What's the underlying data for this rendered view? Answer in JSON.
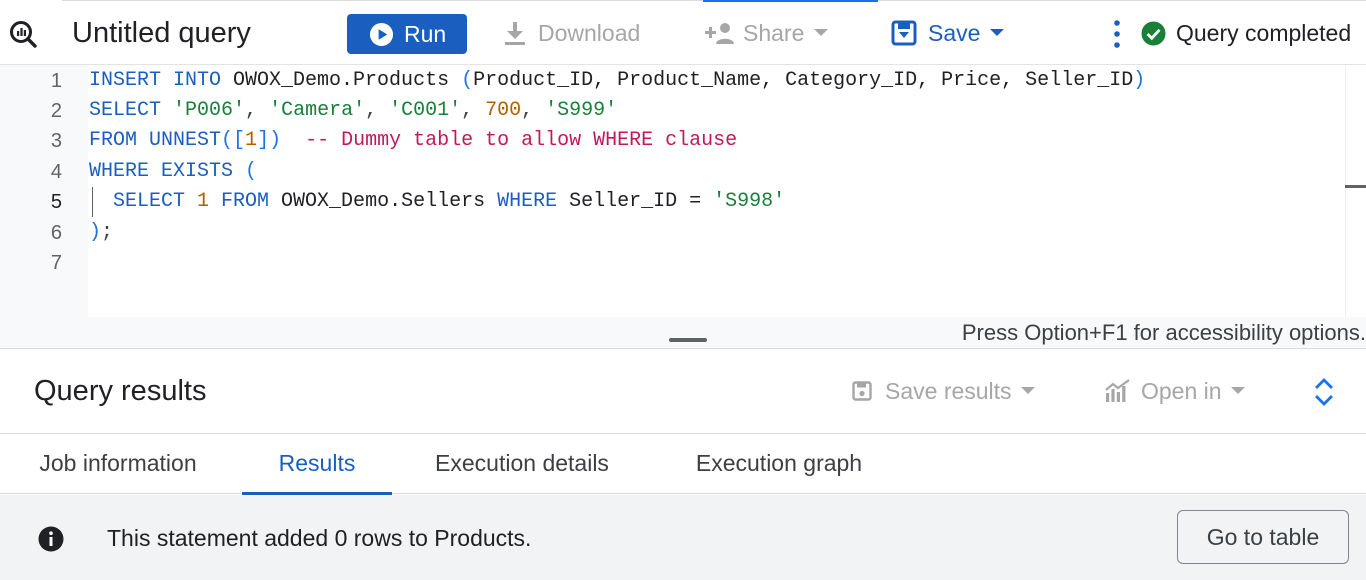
{
  "toolbar": {
    "title": "Untitled query",
    "run_label": "Run",
    "download_label": "Download",
    "share_label": "Share",
    "save_label": "Save",
    "status_text": "Query completed",
    "colors": {
      "primary": "#1a5fbf",
      "success": "#188038",
      "disabled": "#a6a6a6"
    },
    "icons": [
      "query-logo-icon",
      "play-icon",
      "download-icon",
      "share-person-icon",
      "save-icon",
      "more-vert-icon",
      "check-circle-icon"
    ]
  },
  "editor": {
    "line_numbers": [
      "1",
      "2",
      "3",
      "4",
      "5",
      "6",
      "7"
    ],
    "current_line": 5,
    "lines": {
      "l1": {
        "kw": "INSERT INTO",
        "table": " OWOX_Demo.Products ",
        "open": "(",
        "cols": "Product_ID, Product_Name, Category_ID, Price, Seller_ID",
        "close": ")"
      },
      "l2": {
        "kw": "SELECT",
        "sp": " ",
        "v1": "'P006'",
        "c1": ", ",
        "v2": "'Camera'",
        "c2": ", ",
        "v3": "'C001'",
        "c3": ", ",
        "v4": "700",
        "c4": ", ",
        "v5": "'S999'"
      },
      "l3": {
        "kw": "FROM UNNEST",
        "open": "([",
        "num": "1",
        "close": "])",
        "comment": "  -- Dummy table to allow WHERE clause"
      },
      "l4": {
        "kw": "WHERE EXISTS",
        "open": " ("
      },
      "l5": {
        "kw1": "  SELECT",
        "num": " 1",
        "kw2": " FROM",
        "table": " OWOX_Demo.Sellers ",
        "kw3": "WHERE",
        "col": " Seller_ID = ",
        "str": "'S998'"
      },
      "l6": {
        "close": ")",
        "semi": ";"
      }
    },
    "accessibility_hint": "Press Option+F1 for accessibility options."
  },
  "results": {
    "title": "Query results",
    "save_results_label": "Save results",
    "open_in_label": "Open in",
    "tabs": [
      {
        "label": "Job information",
        "selected": false
      },
      {
        "label": "Results",
        "selected": true
      },
      {
        "label": "Execution details",
        "selected": false
      },
      {
        "label": "Execution graph",
        "selected": false
      }
    ],
    "message": "This statement added 0 rows to Products.",
    "go_to_table_label": "Go to table"
  }
}
